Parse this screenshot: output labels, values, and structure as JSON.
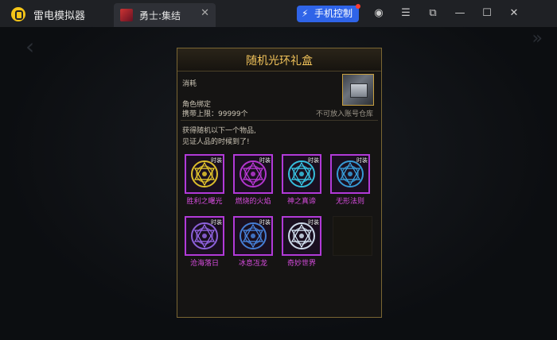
{
  "app": {
    "title": "雷电模拟器"
  },
  "tab": {
    "label": "勇士:集结"
  },
  "toolbar": {
    "mobile_control": "手机控制"
  },
  "dialog": {
    "title": "随机光环礼盒",
    "consume_label": "消耗",
    "bind_label": "角色绑定",
    "carry_limit": "携带上限：99999个",
    "no_account_storage": "不可放入账号仓库",
    "desc_line1": "获得随机以下一个物品,",
    "desc_line2": "见证人品的时候到了!",
    "items": [
      {
        "name": "胜利之曙光",
        "tag": "时装",
        "color": "#f2d22e"
      },
      {
        "name": "燃烧的火焰",
        "tag": "时装",
        "color": "#c23ae0"
      },
      {
        "name": "神之真谛",
        "tag": "时装",
        "color": "#3ad0f0"
      },
      {
        "name": "无形法则",
        "tag": "时装",
        "color": "#3aa8e8"
      },
      {
        "name": "沧海落日",
        "tag": "时装",
        "color": "#9a6af0"
      },
      {
        "name": "冰息冱龙",
        "tag": "时装",
        "color": "#4a8ae8"
      },
      {
        "name": "奇妙世界",
        "tag": "时装",
        "color": "#e0f0ff"
      }
    ]
  }
}
